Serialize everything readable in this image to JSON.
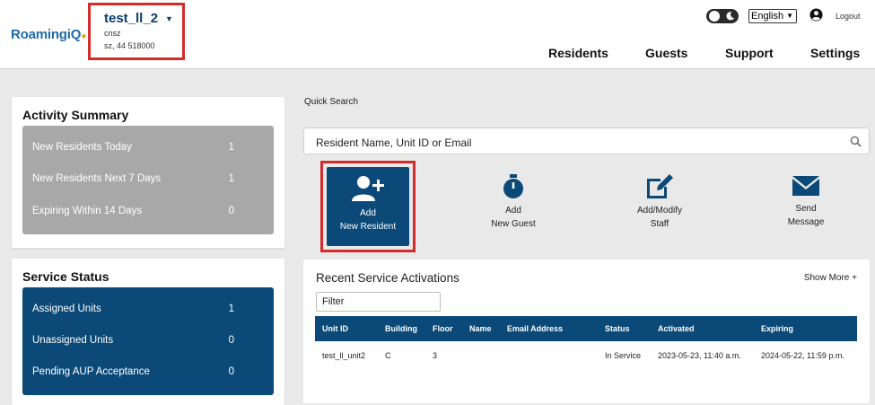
{
  "brand": {
    "logo_text": "Roaming",
    "logo_iq": "iQ"
  },
  "property": {
    "name": "test_ll_2",
    "code": "cnsz",
    "address": "sz, 44 518000"
  },
  "header": {
    "language": "English",
    "logout": "Logout"
  },
  "nav": [
    "Residents",
    "Guests",
    "Support",
    "Settings"
  ],
  "activity": {
    "title": "Activity Summary",
    "rows": [
      {
        "label": "New Residents Today",
        "value": "1"
      },
      {
        "label": "New Residents Next 7 Days",
        "value": "1"
      },
      {
        "label": "Expiring Within 14 Days",
        "value": "0"
      }
    ]
  },
  "service": {
    "title": "Service Status",
    "rows": [
      {
        "label": "Assigned Units",
        "value": "1"
      },
      {
        "label": "Unassigned Units",
        "value": "0"
      },
      {
        "label": "Pending AUP Acceptance",
        "value": "0"
      }
    ]
  },
  "quick_search": {
    "label": "Quick Search",
    "placeholder": "Resident Name, Unit ID or Email"
  },
  "actions": [
    {
      "line1": "Add",
      "line2": "New Resident"
    },
    {
      "line1": "Add",
      "line2": "New Guest"
    },
    {
      "line1": "Add/Modify",
      "line2": "Staff"
    },
    {
      "line1": "Send",
      "line2": "Message"
    }
  ],
  "recent": {
    "title": "Recent Service Activations",
    "show_more": "Show More +",
    "filter_placeholder": "Filter",
    "columns": [
      "Unit ID",
      "Building",
      "Floor",
      "Name",
      "Email Address",
      "Status",
      "Activated",
      "Expiring"
    ],
    "rows": [
      [
        "test_ll_unit2",
        "C",
        "3",
        "",
        "",
        "In Service",
        "2023-05-23, 11:40 a.m.",
        "2024-05-22, 11:59 p.m."
      ]
    ]
  },
  "colors": {
    "primary": "#0b4a78",
    "highlight": "#d42b2b",
    "panel_gray": "#a8a8a8"
  }
}
